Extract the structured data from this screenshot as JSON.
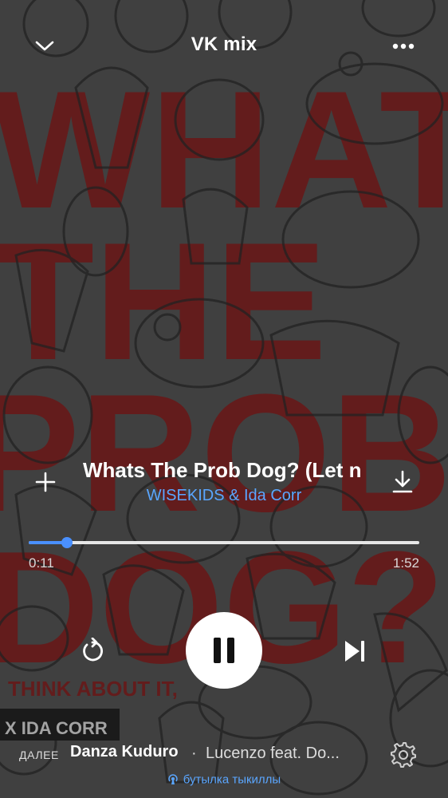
{
  "header": {
    "title": "VK mix",
    "collapse_icon": "chevron-down-icon",
    "more_icon": "more-horizontal-icon"
  },
  "artwork": {
    "text_lines": [
      "WHAT",
      "THE",
      "PROB",
      "DOG?"
    ],
    "sub_text": "THINK ABOUT IT,",
    "corner_text": "X IDA CORR",
    "accent_color": "#a11a1a"
  },
  "track": {
    "title": "Whats The Prob Dog? (Let n",
    "artist": "WISEKIDS & Ida Corr",
    "add_icon": "plus-icon",
    "download_icon": "download-icon"
  },
  "progress": {
    "current": "0:11",
    "duration": "1:52",
    "fraction": 0.098
  },
  "controls": {
    "repeat_icon": "repeat-icon",
    "play_pause_icon": "pause-icon",
    "next_icon": "skip-next-icon"
  },
  "up_next": {
    "label": "ДАЛЕЕ",
    "track": "Danza Kuduro",
    "separator": "·",
    "artist": "Lucenzo feat. Do...",
    "settings_icon": "gear-icon"
  },
  "broadcast": {
    "text": "бутылка тыкиллы",
    "icon": "broadcast-icon"
  },
  "colors": {
    "accent": "#4a90ff",
    "link": "#5aa6ff"
  }
}
